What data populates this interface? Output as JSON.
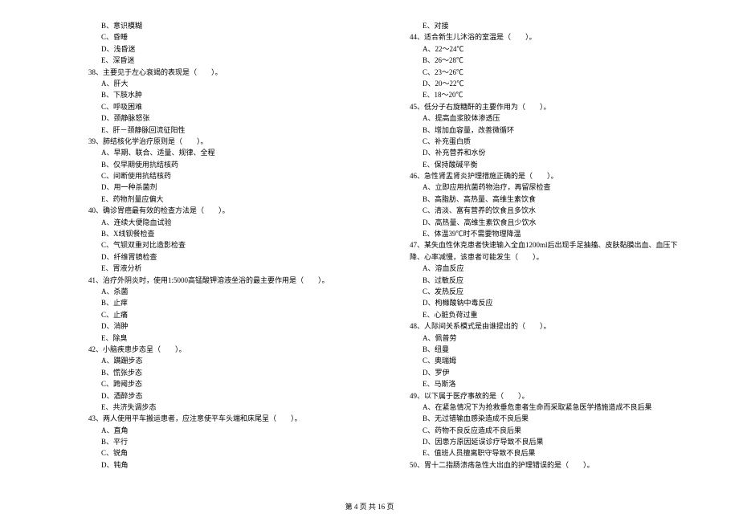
{
  "left": {
    "opts_pre": [
      "B、意识模糊",
      "C、昏睡",
      "D、浅昏迷",
      "E、深昏迷"
    ],
    "q38": "38、主要见于左心衰竭的表现是（　　）。",
    "q38_opts": [
      "A、肝大",
      "B、下肢水肿",
      "C、呼吸困难",
      "D、颈静脉怒张",
      "E、肝－颈静脉回流征阳性"
    ],
    "q39": "39、肺结核化学治疗原则是（　　）。",
    "q39_opts": [
      "A、早期、联合、适量、规律、全程",
      "B、仅早期使用抗结核药",
      "C、间断使用抗结核药",
      "D、用一种杀菌剂",
      "E、药物剂量应偏大"
    ],
    "q40": "40、确诊胃癌最有效的检查方法是（　　）。",
    "q40_opts": [
      "A、连续大便隐血试验",
      "B、X线钡餐检查",
      "C、气钡双重对比造影检查",
      "D、纤维胃镜检查",
      "E、胃液分析"
    ],
    "q41": "41、治疗外阴炎时，使用1:5000高锰酸钾溶液坐浴的最主要作用是（　　）。",
    "q41_opts": [
      "A、杀菌",
      "B、止痒",
      "C、止痛",
      "D、消肿",
      "E、除臭"
    ],
    "q42": "42、小脑疾患步态呈（　　）。",
    "q42_opts": [
      "A、蹒跚步态",
      "B、慌张步态",
      "C、跨阈步态",
      "D、酒醉步态",
      "E、共济失调步态"
    ],
    "q43": "43、两人使用平车搬运患者，应注意使平车头端和床尾呈（　　）。",
    "q43_opts": [
      "A、直角",
      "B、平行",
      "C、锐角",
      "D、钝角"
    ]
  },
  "right": {
    "opts_pre": [
      "E、对接"
    ],
    "q44": "44、适合新生儿沐浴的室温是（　　）。",
    "q44_opts": [
      "A、22～24℃",
      "B、26～28℃",
      "C、23～26℃",
      "D、20～22℃",
      "E、18～20℃"
    ],
    "q45": "45、低分子右旋糖酐的主要作用为（　　）。",
    "q45_opts": [
      "A、提高血浆胶体渗透压",
      "B、增加血容量，改善微循环",
      "C、补充蛋白质",
      "D、补充营养和水份",
      "E、保持酸碱平衡"
    ],
    "q46": "46、急性肾盂肾炎护理措施正确的是（　　）。",
    "q46_opts": [
      "A、立即应用抗菌药物治疗，再留尿检查",
      "B、高脂肪、高热量、高维生素饮食",
      "C、清淡、富有营养的饮食且多饮水",
      "D、高热量、高维生素饮食且少饮水",
      "E、体温39℃时不需要物理降温"
    ],
    "q47": "47、某失血性休克患者快速输入全血1200ml后出现手足抽搐、皮肤黏膜出血、血压下降、心率减慢，该患者可能发生（　　）。",
    "q47_opts": [
      "A、溶血反应",
      "B、过敏反应",
      "C、发热反应",
      "D、枸橼酸钠中毒反应",
      "E、心脏负荷过重"
    ],
    "q48": "48、人际间关系模式是由谁提出的（　　）。",
    "q48_opts": [
      "A、佩普劳",
      "B、纽曼",
      "C、奥瑞姆",
      "D、罗伊",
      "E、马斯洛"
    ],
    "q49": "49、以下属于医疗事故的是（　　）。",
    "q49_opts": [
      "A、在紧急情况下为抢救垂危患者生命而采取紧急医学措施造成不良后果",
      "B、无过错输血感染造成不良后果",
      "C、药物不良反应造成不良后果",
      "D、因患方原因延误诊疗导致不良后果",
      "E、值班人员擅离职守导致不良后果"
    ],
    "q50": "50、胃十二指肠溃疡急性大出血的护理错误的是（　　）。"
  },
  "footer": "第 4 页 共 16 页"
}
